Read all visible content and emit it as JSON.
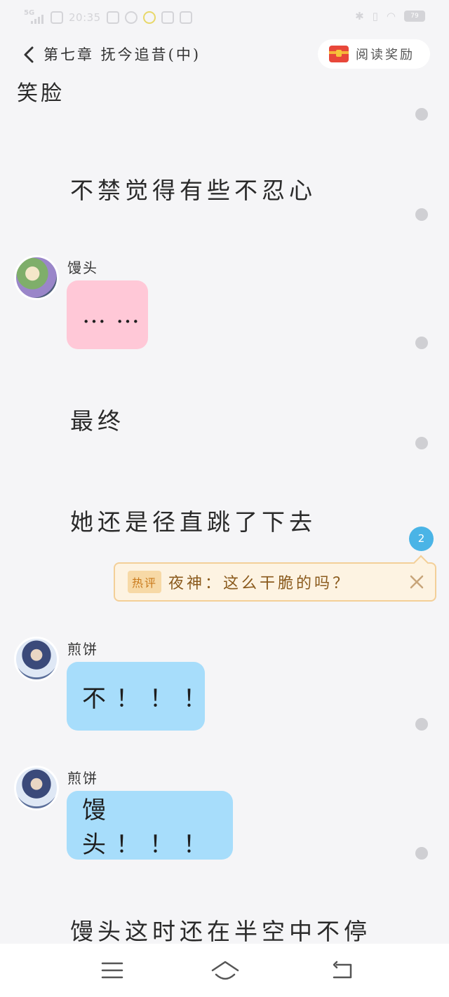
{
  "status_bar": {
    "signal_label": "5G",
    "time": "20:35",
    "battery": "79"
  },
  "header": {
    "chapter_title": "第七章  抚今追昔(中)",
    "reward_label": "阅读奖励",
    "icons": [
      "back-chevron-icon",
      "treasure-chest-icon"
    ]
  },
  "content": {
    "top_partial_text": "笑脸",
    "narrations": [
      "不禁觉得有些不忍心",
      "最终",
      "她还是径直跳了下去",
      "馒头这时还在半空中不停"
    ],
    "messages": [
      {
        "speaker": "馒头",
        "text": "……"
      },
      {
        "speaker": "煎饼",
        "text": "不！！！"
      },
      {
        "speaker": "煎饼",
        "text": "馒头！！！"
      }
    ],
    "hot_comment": {
      "badge": "热评",
      "text": "夜神：这么干脆的吗？",
      "count": "2"
    }
  },
  "colors": {
    "background": "#f5f5f7",
    "bubble_pink": "#ffc8d7",
    "bubble_blue": "#a7ddfb",
    "comment_bg": "#fdf3e2",
    "comment_count": "#4ab4e6"
  },
  "nav_bar": {
    "icons": [
      "menu-icon",
      "home-icon",
      "back-icon"
    ]
  }
}
